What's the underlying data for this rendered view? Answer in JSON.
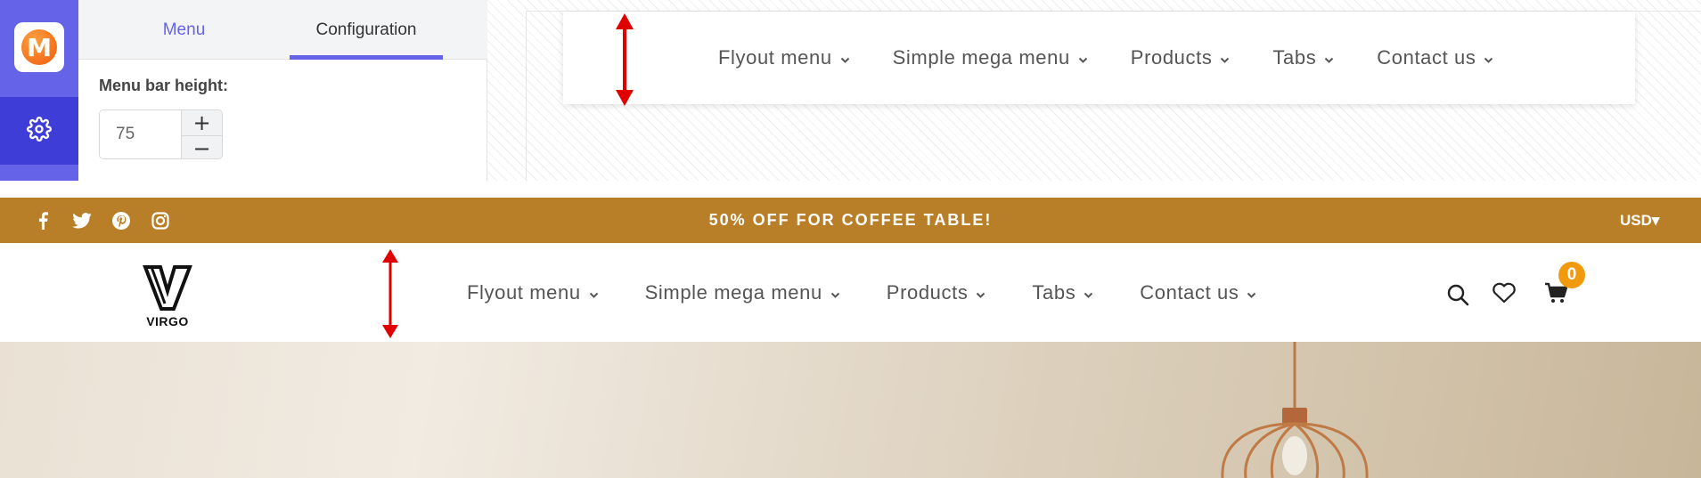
{
  "editor": {
    "tabs": [
      {
        "label": "Menu"
      },
      {
        "label": "Configuration"
      }
    ],
    "menu_bar_height_label": "Menu bar height:",
    "menu_bar_height_value": "75",
    "stepper": {
      "plus": "+",
      "minus": "−"
    },
    "rail_icons": [
      "app-logo-icon",
      "gear-icon"
    ],
    "accent_color": "#6563e8"
  },
  "preview_nav": {
    "items": [
      {
        "label": "Flyout menu"
      },
      {
        "label": "Simple mega menu"
      },
      {
        "label": "Products"
      },
      {
        "label": "Tabs"
      },
      {
        "label": "Contact us"
      }
    ]
  },
  "store": {
    "announcement": "50% OFF FOR COFFEE TABLE!",
    "announcement_bg": "#b97f28",
    "social_icons": [
      "facebook-icon",
      "twitter-icon",
      "pinterest-icon",
      "instagram-icon"
    ],
    "currency": "USD",
    "brand": "VIRGO",
    "nav": {
      "items": [
        {
          "label": "Flyout menu"
        },
        {
          "label": "Simple mega menu"
        },
        {
          "label": "Products"
        },
        {
          "label": "Tabs"
        },
        {
          "label": "Contact us"
        }
      ]
    },
    "cart_count": "0",
    "header_icons": [
      "search-icon",
      "heart-icon",
      "cart-icon"
    ]
  }
}
